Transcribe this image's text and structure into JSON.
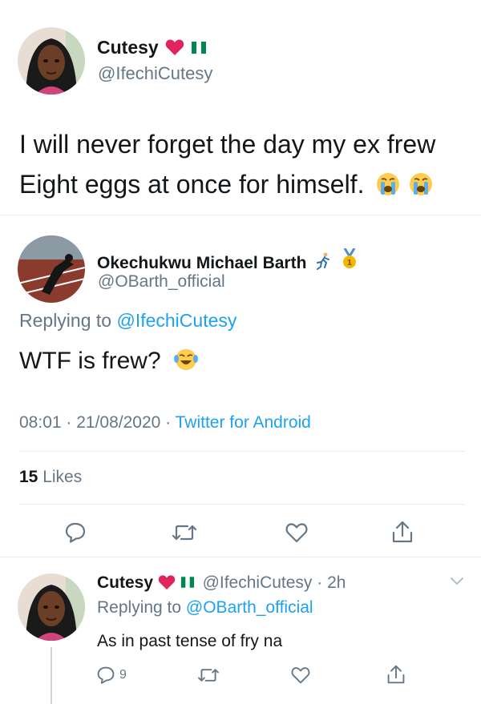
{
  "tweet1": {
    "name": "Cutesy",
    "handle": "@IfechiCutesy",
    "text_line1": "I will never forget the day my ex frew",
    "text_line2": "Eight eggs at once for himself.",
    "emoji": "crying-face"
  },
  "tweet2": {
    "name": "Okechukwu Michael Barth",
    "handle": "@OBarth_official",
    "replying_prefix": "Replying to",
    "replying_to": "@IfechiCutesy",
    "text": "WTF is frew?",
    "meta_time": "08:01 · 21/08/2020 ·",
    "meta_source": "Twitter for Android",
    "likes_count": "15",
    "likes_label": "Likes"
  },
  "tweet3": {
    "name": "Cutesy",
    "handle_time": "@IfechiCutesy · 2h",
    "replying_prefix": "Replying to",
    "replying_to": "@OBarth_official",
    "text": "As in past tense of fry na",
    "reply_count": "9"
  },
  "colors": {
    "accent": "#1da1f2",
    "muted": "#657786",
    "text": "#14171a",
    "divider": "#e6ecf0",
    "heart_red": "#e0245e",
    "flag_green": "#008751"
  }
}
